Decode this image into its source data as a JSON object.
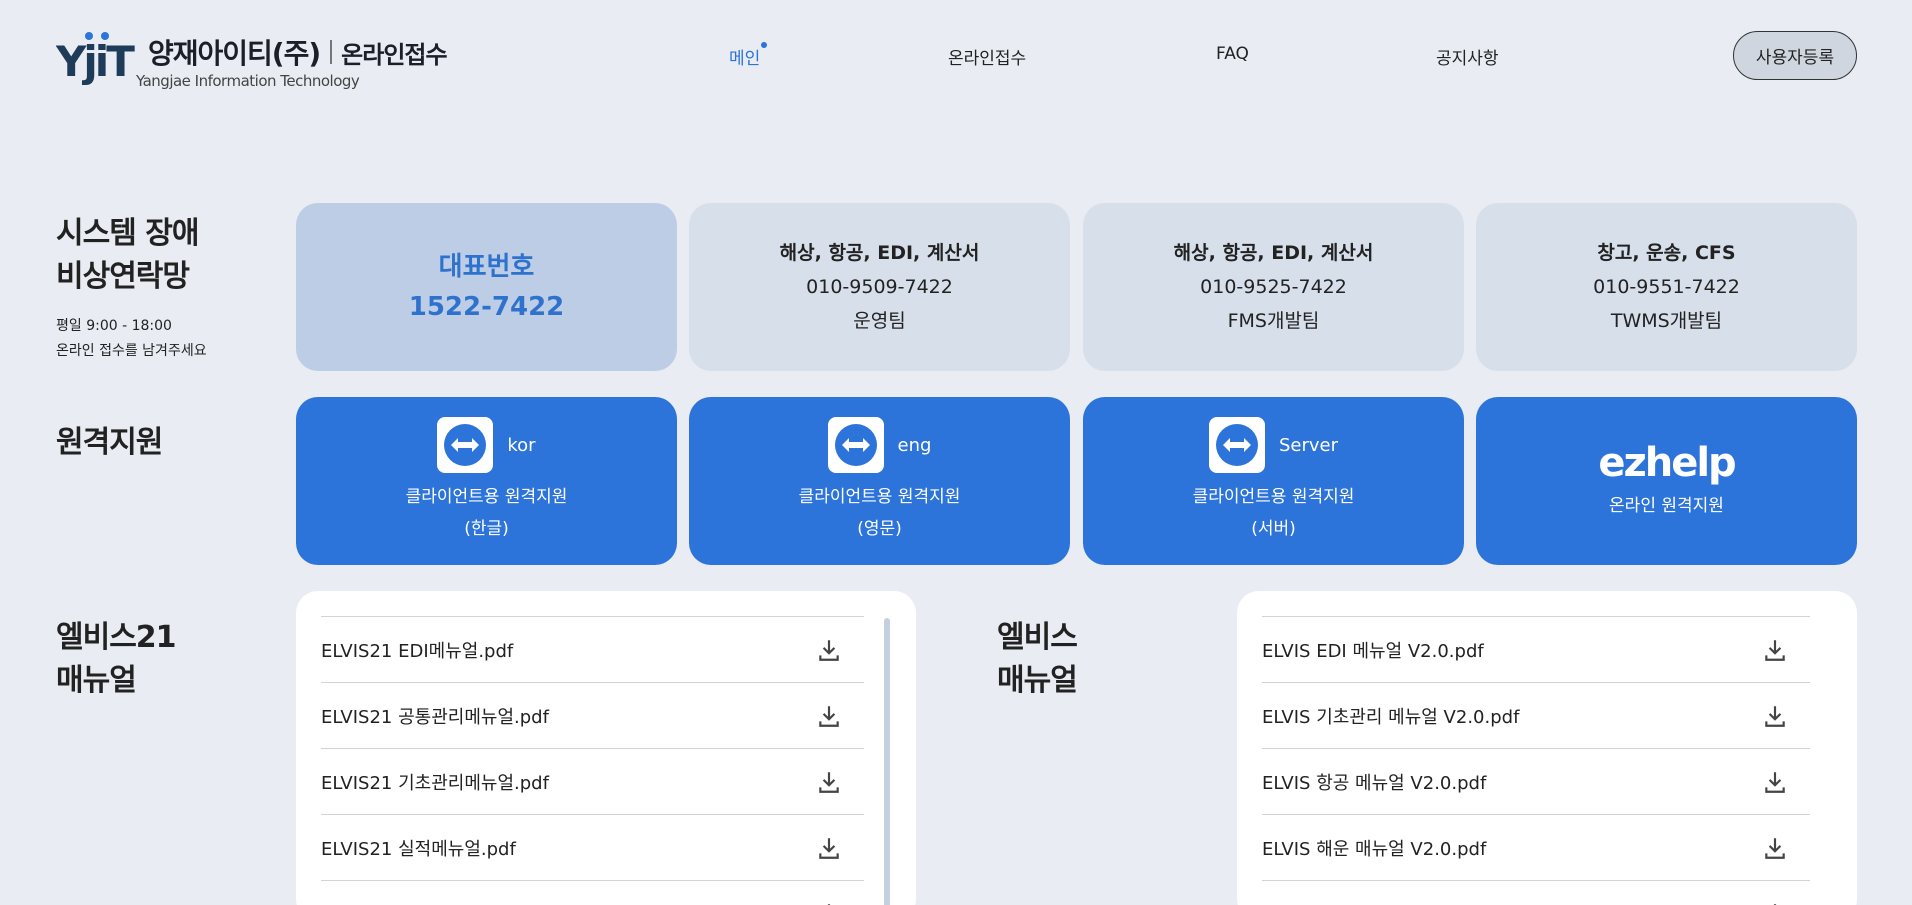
{
  "header": {
    "brand_name": "양재아이티(주)",
    "brand_sub": "온라인접수",
    "brand_eng": "Yangjae Information Technology",
    "nav": [
      "메인",
      "온라인접수",
      "FAQ",
      "공지사항"
    ],
    "register_label": "사용자등록"
  },
  "emergency": {
    "title_line1": "시스템 장애",
    "title_line2": "비상연락망",
    "hours": "평일 9:00 - 18:00",
    "note": "온라인 접수를 남겨주세요",
    "main_label": "대표번호",
    "main_number": "1522-7422",
    "cards": [
      {
        "title": "해상, 항공, EDI, 계산서",
        "phone": "010-9509-7422",
        "team": "운영팀"
      },
      {
        "title": "해상, 항공, EDI, 계산서",
        "phone": "010-9525-7422",
        "team": "FMS개발팀"
      },
      {
        "title": "창고, 운송, CFS",
        "phone": "010-9551-7422",
        "team": "TWMS개발팀"
      }
    ]
  },
  "remote": {
    "title": "원격지원",
    "cards": [
      {
        "tag": "kor",
        "line1": "클라이언트용 원격지원",
        "line2": "(한글)"
      },
      {
        "tag": "eng",
        "line1": "클라이언트용 원격지원",
        "line2": "(영문)"
      },
      {
        "tag": "Server",
        "line1": "클라이언트용 원격지원",
        "line2": "(서버)"
      }
    ],
    "ezhelp_logo": "ezhelp",
    "ezhelp_label": "온라인 원격지원"
  },
  "manual21": {
    "title_line1": "엘비스21",
    "title_line2": "매뉴얼",
    "files": [
      "ELVIS21 EDI메뉴얼.pdf",
      "ELVIS21 공통관리메뉴얼.pdf",
      "ELVIS21 기초관리메뉴얼.pdf",
      "ELVIS21 실적메뉴얼.pdf"
    ]
  },
  "manual": {
    "title_line1": "엘비스",
    "title_line2": "매뉴얼",
    "files": [
      "ELVIS EDI 메뉴얼 V2.0.pdf",
      "ELVIS 기초관리 메뉴얼 V2.0.pdf",
      "ELVIS 항공 메뉴얼 V2.0.pdf",
      "ELVIS 해운 매뉴얼 V2.0.pdf"
    ]
  },
  "colors": {
    "accent": "#2d74da",
    "background": "#e9edf3",
    "card": "#d7dfeb",
    "card_main": "#bccde5"
  },
  "icons": {
    "download": "download-icon",
    "teamviewer": "teamviewer-icon"
  }
}
